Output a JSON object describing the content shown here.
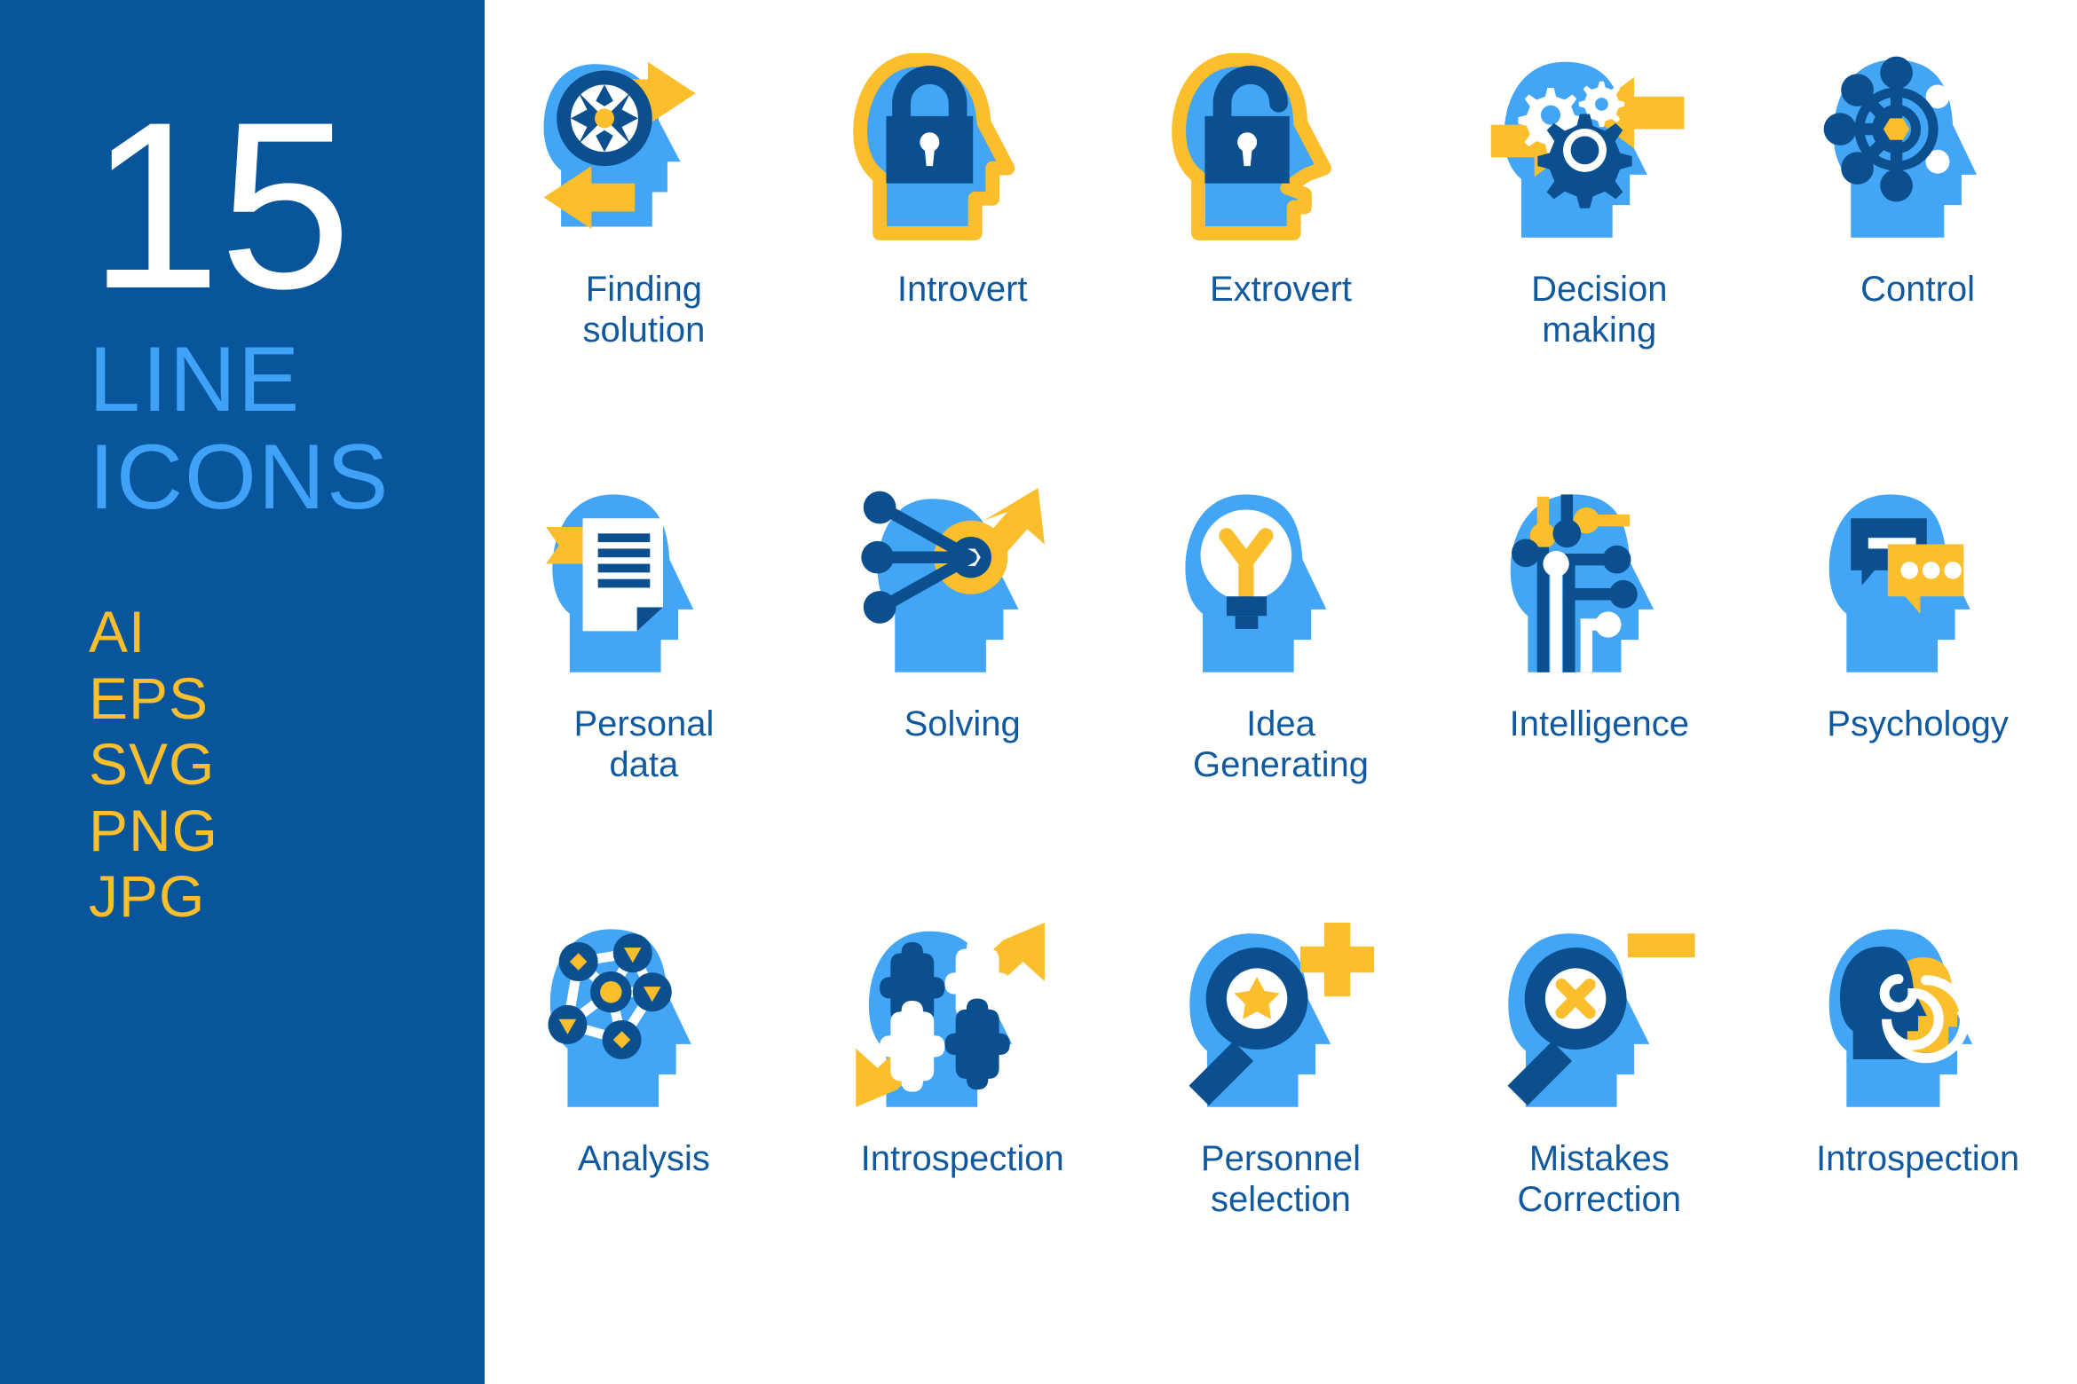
{
  "sidebar": {
    "count": "15",
    "kicker_line1": "LINE",
    "kicker_line2": "ICONS",
    "formats": [
      "AI",
      "EPS",
      "SVG",
      "PNG",
      "JPG"
    ],
    "bg_color": "#08559B",
    "count_color": "#FFFFFF",
    "kicker_color": "#3FA2F7",
    "format_color": "#FBBE2C"
  },
  "palette": {
    "dark_blue": "#0B4F8F",
    "light_blue": "#42A5F5",
    "yellow": "#FBBE2C",
    "white": "#FFFFFF",
    "label_blue": "#11599F"
  },
  "grid": {
    "columns": 5,
    "rows": 3,
    "items": [
      {
        "icon": "head-compass-arrows-icon",
        "label": "Finding\nsolution",
        "line1": "Finding",
        "line2": "solution"
      },
      {
        "icon": "head-closed-lock-icon",
        "label": "Introvert",
        "line1": "Introvert",
        "line2": ""
      },
      {
        "icon": "head-open-lock-icon",
        "label": "Extrovert",
        "line1": "Extrovert",
        "line2": ""
      },
      {
        "icon": "head-gears-arrows-icon",
        "label": "Decision\nmaking",
        "line1": "Decision",
        "line2": "making"
      },
      {
        "icon": "head-ship-wheel-icon",
        "label": "Control",
        "line1": "Control",
        "line2": ""
      },
      {
        "icon": "head-document-icon",
        "label": "Personal\ndata",
        "line1": "Personal",
        "line2": "data"
      },
      {
        "icon": "head-target-arrow-icon",
        "label": "Solving",
        "line1": "Solving",
        "line2": ""
      },
      {
        "icon": "head-lightbulb-icon",
        "label": "Idea\nGenerating",
        "line1": "Idea",
        "line2": "Generating"
      },
      {
        "icon": "head-circuit-icon",
        "label": "Intelligence",
        "line1": "Intelligence",
        "line2": ""
      },
      {
        "icon": "head-speech-bubbles-icon",
        "label": "Psychology",
        "line1": "Psychology",
        "line2": ""
      },
      {
        "icon": "head-network-nodes-icon",
        "label": "Analysis",
        "line1": "Analysis",
        "line2": ""
      },
      {
        "icon": "head-puzzle-arrows-icon",
        "label": "Introspection",
        "line1": "Introspection",
        "line2": ""
      },
      {
        "icon": "head-magnifier-star-icon",
        "label": "Personnel\nselection",
        "line1": "Personnel",
        "line2": "selection"
      },
      {
        "icon": "head-magnifier-cross-icon",
        "label": "Mistakes\nCorrection",
        "line1": "Mistakes",
        "line2": "Correction"
      },
      {
        "icon": "head-spiral-faces-icon",
        "label": "Introspection",
        "line1": "Introspection",
        "line2": ""
      }
    ]
  }
}
